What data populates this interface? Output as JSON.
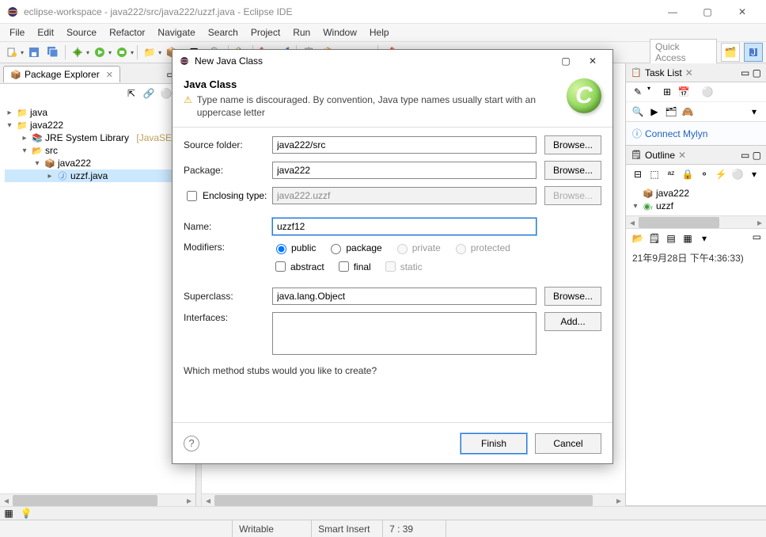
{
  "window": {
    "title": "eclipse-workspace - java222/src/java222/uzzf.java - Eclipse IDE"
  },
  "menu": [
    "File",
    "Edit",
    "Source",
    "Refactor",
    "Navigate",
    "Search",
    "Project",
    "Run",
    "Window",
    "Help"
  ],
  "quick_access": {
    "placeholder": "Quick Access"
  },
  "left": {
    "view_title": "Package Explorer",
    "tree": {
      "java": "java",
      "java222": "java222",
      "jre": "JRE System Library",
      "jre_suffix": "[JavaSE",
      "src": "src",
      "pkg": "java222",
      "file": "uzzf.java"
    }
  },
  "right": {
    "task_list": "Task List",
    "connect": "Connect Mylyn",
    "outline": "Outline",
    "outline_items": {
      "pkg": "java222",
      "cls": "uzzf"
    },
    "timestamp": "21年9月28日 下午4:36:33)"
  },
  "status": {
    "writable": "Writable",
    "insert": "Smart Insert",
    "pos": "7 : 39"
  },
  "dialog": {
    "title": "New Java Class",
    "header": "Java Class",
    "warning": "Type name is discouraged. By convention, Java type names usually start with an uppercase letter",
    "source_folder_lbl": "Source folder:",
    "source_folder": "java222/src",
    "package_lbl": "Package:",
    "package": "java222",
    "enclosing_lbl": "Enclosing type:",
    "enclosing": "java222.uzzf",
    "name_lbl": "Name:",
    "name": "uzzf12",
    "modifiers_lbl": "Modifiers:",
    "modifiers": {
      "public": "public",
      "package": "package",
      "private": "private",
      "protected": "protected",
      "abstract": "abstract",
      "final": "final",
      "static": "static"
    },
    "superclass_lbl": "Superclass:",
    "superclass": "java.lang.Object",
    "interfaces_lbl": "Interfaces:",
    "stubs_q": "Which method stubs would you like to create?",
    "browse": "Browse...",
    "add": "Add...",
    "finish": "Finish",
    "cancel": "Cancel"
  }
}
